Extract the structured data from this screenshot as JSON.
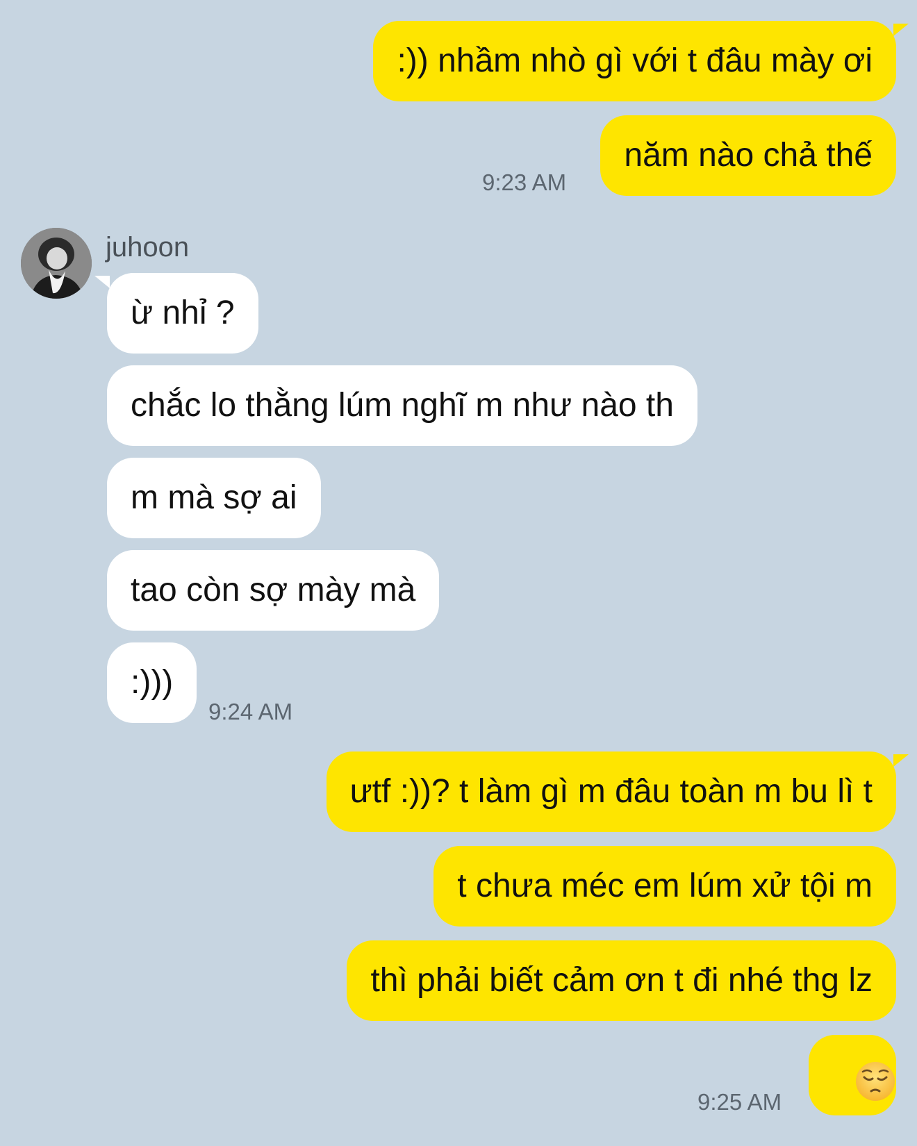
{
  "conversation": {
    "outgoing_group_1": [
      {
        "text": ":)) nhầm nhò gì với t đâu mày ơi"
      },
      {
        "text": "năm nào chả thế"
      }
    ],
    "outgoing_group_1_time": "9:23 AM",
    "incoming_sender": "juhoon",
    "incoming_group": [
      {
        "text": "ừ nhỉ ?"
      },
      {
        "text": "chắc lo thằng lúm nghĩ m như nào th"
      },
      {
        "text": "m mà sợ ai"
      },
      {
        "text": "tao còn sợ mày mà"
      },
      {
        "text": ":)))"
      }
    ],
    "incoming_group_time": "9:24 AM",
    "outgoing_group_2": [
      {
        "text": "ưtf :))? t làm gì m đâu toàn m bu lì t"
      },
      {
        "text": "t chưa méc em lúm xử tội m"
      },
      {
        "text": "thì phải biết cảm ơn t đi nhé thg lz"
      },
      {
        "emoji": "pensive-face"
      }
    ],
    "outgoing_group_2_time": "9:25 AM"
  },
  "colors": {
    "background": "#c7d5e1",
    "outgoing_bubble": "#fee500",
    "incoming_bubble": "#ffffff",
    "timestamp": "#5c6670"
  }
}
